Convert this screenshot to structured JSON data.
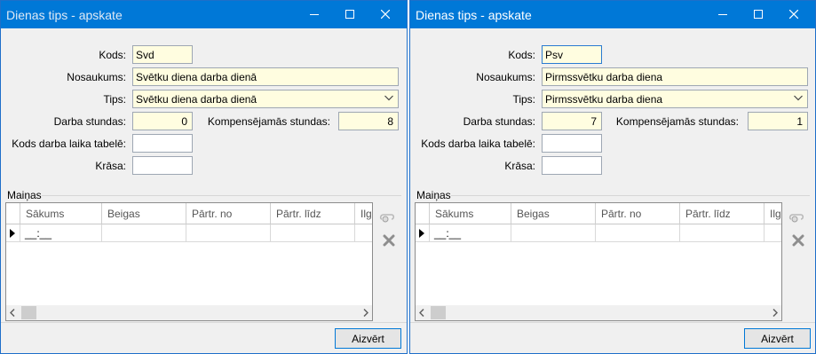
{
  "windows": [
    {
      "title": "Dienas tips - apskate",
      "labels": {
        "kods": "Kods:",
        "nosaukums": "Nosaukums:",
        "tips": "Tips:",
        "darba_stundas": "Darba stundas:",
        "kompensejamas": "Kompensējamās stundas:",
        "kods_tabele": "Kods darba laika tabelē:",
        "krasa": "Krāsa:"
      },
      "fields": {
        "kods": "Svd",
        "nosaukums": "Svētku diena darba dienā",
        "tips": "Svētku diena darba dienā",
        "darba_stundas": "0",
        "kompensejamas": "8",
        "kods_tabele": "",
        "krasa": ""
      },
      "group_label": "Maiņas",
      "grid": {
        "columns": [
          "Sākums",
          "Beigas",
          "Pārtr. no",
          "Pārtr. līdz",
          "Ilgums"
        ],
        "rows": [
          [
            "__:__",
            "",
            "",
            "",
            ""
          ]
        ]
      },
      "close_button": "Aizvērt"
    },
    {
      "title": "Dienas tips - apskate",
      "labels": {
        "kods": "Kods:",
        "nosaukums": "Nosaukums:",
        "tips": "Tips:",
        "darba_stundas": "Darba stundas:",
        "kompensejamas": "Kompensējamās stundas:",
        "kods_tabele": "Kods darba laika tabelē:",
        "krasa": "Krāsa:"
      },
      "fields": {
        "kods": "Psv",
        "nosaukums": "Pirmssvētku darba diena",
        "tips": "Pirmssvētku darba diena",
        "darba_stundas": "7",
        "kompensejamas": "1",
        "kods_tabele": "",
        "krasa": ""
      },
      "group_label": "Maiņas",
      "grid": {
        "columns": [
          "Sākums",
          "Beigas",
          "Pārtr. no",
          "Pārtr. līdz",
          "Ilgums"
        ],
        "rows": [
          [
            "__:__",
            "",
            "",
            "",
            ""
          ]
        ]
      },
      "close_button": "Aizvērt"
    }
  ],
  "colors": {
    "titlebar": "#0078d7",
    "field_readonly": "#fffde0",
    "field_focus_border": "#2a7bd1"
  },
  "icons": [
    "minimize-icon",
    "maximize-icon",
    "close-icon",
    "chevron-down-icon",
    "row-indicator-icon",
    "add-record-icon",
    "delete-record-icon",
    "scroll-left-icon",
    "scroll-right-icon"
  ]
}
